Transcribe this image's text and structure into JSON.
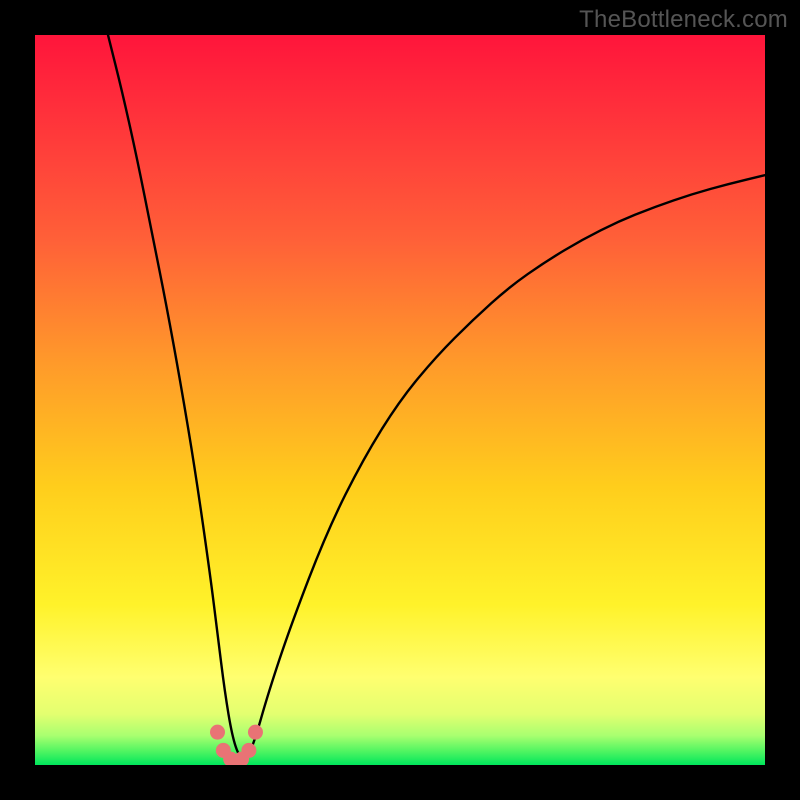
{
  "watermark": "TheBottleneck.com",
  "colors": {
    "frame": "#000000",
    "gradient_top": "#ff1a3a",
    "gradient_mid": "#ffba00",
    "gradient_low": "#ffff66",
    "gradient_bottom": "#00e65c",
    "curve": "#000000",
    "dots": "#e97375"
  },
  "chart_data": {
    "type": "line",
    "title": "",
    "xlabel": "",
    "ylabel": "",
    "xlim": [
      0,
      100
    ],
    "ylim": [
      0,
      100
    ],
    "series": [
      {
        "name": "bottleneck-curve",
        "x": [
          10,
          12,
          14,
          16,
          18,
          20,
          22,
          24,
          25,
          26,
          27,
          28,
          29,
          30,
          32,
          35,
          40,
          45,
          50,
          55,
          60,
          65,
          70,
          75,
          80,
          85,
          90,
          95,
          100
        ],
        "y": [
          100,
          92,
          83,
          73,
          63,
          52,
          40,
          26,
          18,
          10,
          4,
          1,
          1,
          3,
          10,
          19,
          32,
          42,
          50,
          56,
          61,
          65.5,
          69,
          72,
          74.5,
          76.5,
          78.2,
          79.6,
          80.8
        ]
      }
    ],
    "markers": {
      "name": "valley-dots",
      "x": [
        25.0,
        25.8,
        26.8,
        27.5,
        28.3,
        29.3,
        30.2
      ],
      "y": [
        4.5,
        2.0,
        0.8,
        0.5,
        0.8,
        2.0,
        4.5
      ]
    },
    "annotations": []
  }
}
